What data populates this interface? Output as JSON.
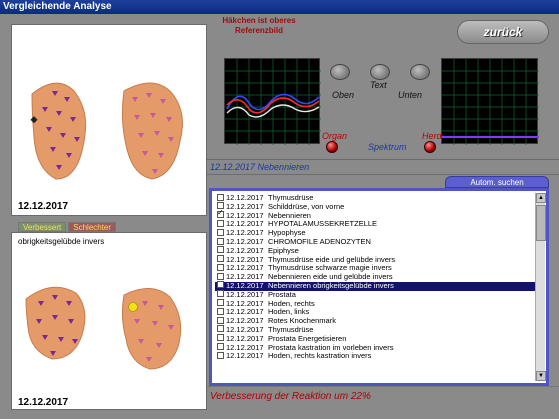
{
  "window": {
    "title": "Vergleichende Analyse"
  },
  "header": {
    "message_line1": "Häkchen ist oberes",
    "message_line2": "Referenzbild",
    "back_button": "zurück"
  },
  "top_panel": {
    "date": "12.12.2017"
  },
  "bottom_panel": {
    "tabs": [
      "Verbessert",
      "Schlechter"
    ],
    "caption": "obrigkeitsgelübde invers",
    "date": "12.12.2017"
  },
  "controls": {
    "knob_labels": [
      "Oben",
      "Text",
      "Unten"
    ],
    "organ_label": "Organ",
    "herd_label": "Herd",
    "spektrum_label": "Spektrum"
  },
  "strip": {
    "text": "12.12.2017 Nebennieren"
  },
  "list": {
    "search_button": "Autom. suchen",
    "rows": [
      {
        "date": "12.12.2017",
        "label": "Thymusdrüse",
        "checked": false,
        "selected": false
      },
      {
        "date": "12.12.2017",
        "label": "Schilddrüse, von vorne",
        "checked": false,
        "selected": false
      },
      {
        "date": "12.12.2017",
        "label": "Nebennieren",
        "checked": true,
        "selected": false
      },
      {
        "date": "12.12.2017",
        "label": "HYPOTALAMUSSEKRETZELLE",
        "checked": false,
        "selected": false
      },
      {
        "date": "12.12.2017",
        "label": "Hypophyse",
        "checked": false,
        "selected": false
      },
      {
        "date": "12.12.2017",
        "label": "CHROMOFILE ADENOZYTEN",
        "checked": false,
        "selected": false
      },
      {
        "date": "12.12.2017",
        "label": "Epiphyse",
        "checked": false,
        "selected": false
      },
      {
        "date": "12.12.2017",
        "label": "Thymusdrüse  eide und gelübde invers",
        "checked": false,
        "selected": false
      },
      {
        "date": "12.12.2017",
        "label": "Thymusdrüse  schwarze magie invers",
        "checked": false,
        "selected": false
      },
      {
        "date": "12.12.2017",
        "label": "Nebennieren  eide und gelübde invers",
        "checked": false,
        "selected": false
      },
      {
        "date": "12.12.2017",
        "label": "Nebennieren  obrigkeitsgelübde invers",
        "checked": false,
        "selected": true
      },
      {
        "date": "12.12.2017",
        "label": "Prostata",
        "checked": false,
        "selected": false
      },
      {
        "date": "12.12.2017",
        "label": "Hoden, rechts",
        "checked": false,
        "selected": false
      },
      {
        "date": "12.12.2017",
        "label": "Hoden, links",
        "checked": false,
        "selected": false
      },
      {
        "date": "12.12.2017",
        "label": "Rotes Knochenmark",
        "checked": false,
        "selected": false
      },
      {
        "date": "12.12.2017",
        "label": "Thymusdrüse",
        "checked": false,
        "selected": false
      },
      {
        "date": "12.12.2017",
        "label": "Prostata  Energetisieren",
        "checked": false,
        "selected": false
      },
      {
        "date": "12.12.2017",
        "label": "Prostata  kastration im vorleben invers",
        "checked": false,
        "selected": false
      },
      {
        "date": "12.12.2017",
        "label": "Hoden, rechts  kastration invers",
        "checked": false,
        "selected": false
      }
    ]
  },
  "status": {
    "text": "Verbesserung der Reaktion um 22%"
  },
  "colors": {
    "accent": "#4f55c4",
    "selection": "#13136e",
    "status": "#b00000"
  }
}
